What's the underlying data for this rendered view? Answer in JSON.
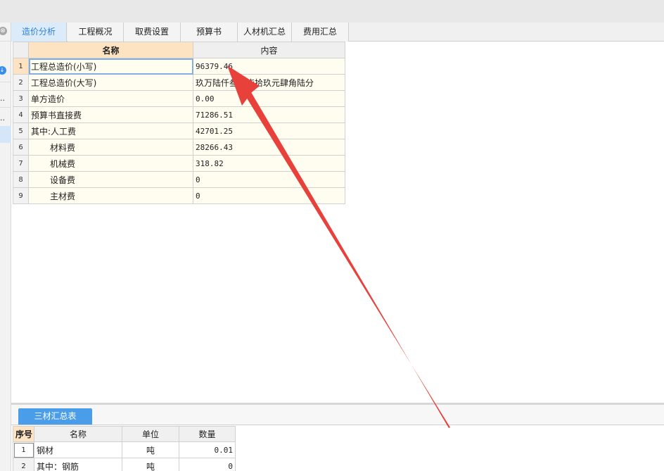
{
  "leftstrip": {
    "top_glyph": "⊗",
    "mid_glyph": "↓",
    "dots": [
      "..",
      ".."
    ]
  },
  "tabs": [
    {
      "label": "造价分析",
      "active": true
    },
    {
      "label": "工程概况",
      "active": false
    },
    {
      "label": "取费设置",
      "active": false
    },
    {
      "label": "预算书",
      "active": false
    },
    {
      "label": "人材机汇总",
      "active": false
    },
    {
      "label": "费用汇总",
      "active": false
    }
  ],
  "main_table": {
    "headers": {
      "name": "名称",
      "content": "内容"
    },
    "rows": [
      {
        "num": "1",
        "name": "工程总造价(小写)",
        "value": "96379.46"
      },
      {
        "num": "2",
        "name": "工程总造价(大写)",
        "value": "玖万陆仟叁佰柒拾玖元肆角陆分"
      },
      {
        "num": "3",
        "name": "单方造价",
        "value": "0.00"
      },
      {
        "num": "4",
        "name": "预算书直接费",
        "value": "71286.51"
      },
      {
        "num": "5",
        "name": "其中:人工费",
        "value": "42701.25"
      },
      {
        "num": "6",
        "name": "材料费",
        "value": "28266.43"
      },
      {
        "num": "7",
        "name": "机械费",
        "value": "318.82"
      },
      {
        "num": "8",
        "name": "设备费",
        "value": "0"
      },
      {
        "num": "9",
        "name": "主材费",
        "value": "0"
      }
    ]
  },
  "bottom": {
    "tab_label": "三材汇总表",
    "headers": {
      "seq": "序号",
      "name": "名称",
      "unit": "单位",
      "qty": "数量"
    },
    "rows": [
      {
        "num": "1",
        "name": "钢材",
        "unit": "吨",
        "qty": "0.01"
      },
      {
        "num": "2",
        "name": "其中：钢筋",
        "unit": "吨",
        "qty": "0"
      }
    ]
  },
  "annotation": {
    "color": "#e8413c",
    "type": "arrow"
  }
}
